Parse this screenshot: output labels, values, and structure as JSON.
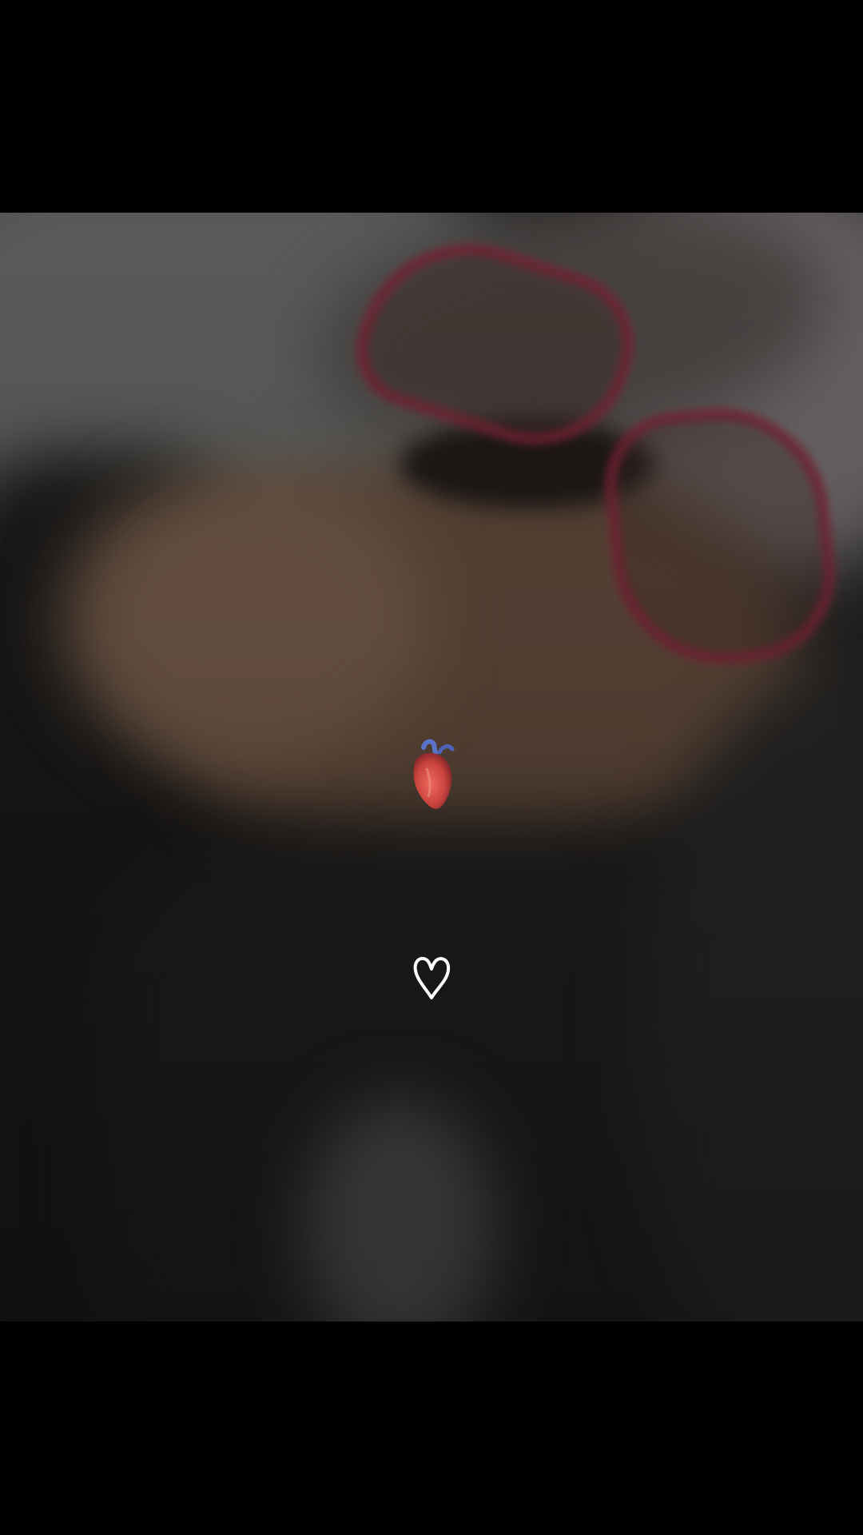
{
  "story": {
    "background_color": "#000000",
    "photo": {
      "description_icon": "blurred-selfie-photo"
    },
    "stickers": [
      {
        "type": "anatomical-heart-icon"
      },
      {
        "type": "heart-outline-icon"
      }
    ]
  }
}
